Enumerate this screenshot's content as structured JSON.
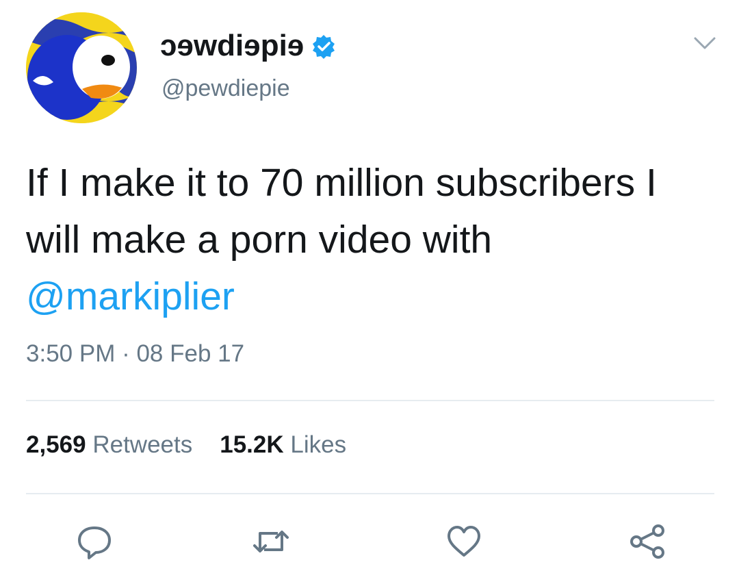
{
  "tweet": {
    "display_name": "ɔɘwdiɘpiɘ",
    "handle": "@pewdiepie",
    "text_before": "If I make it to 70 million subscribers I will make a porn video with ",
    "mention": "@markiplier",
    "timestamp": "3:50 PM · 08 Feb 17",
    "retweets_count": "2,569",
    "retweets_label": "Retweets",
    "likes_count": "15.2K",
    "likes_label": "Likes"
  },
  "icons": {
    "verified": "verified-badge-icon",
    "caret": "chevron-down-icon",
    "reply": "reply-icon",
    "retweet": "retweet-icon",
    "like": "heart-icon",
    "share": "share-icon"
  },
  "colors": {
    "accent": "#1da1f2",
    "secondary_text": "#657786",
    "primary_text": "#14171a",
    "divider": "#e6ecf0"
  }
}
